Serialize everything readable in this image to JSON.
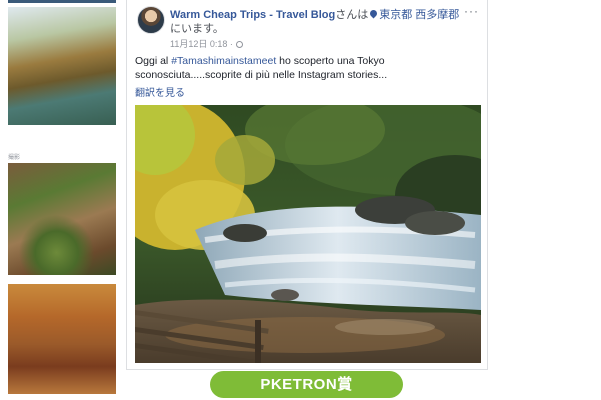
{
  "post": {
    "author": "Warm Cheap Trips - Travel Blog",
    "header_connector": "さんは",
    "location": "東京都 西多摩郡",
    "header_suffix": "にいます。",
    "timestamp": "11月12日 0:18 ·",
    "text_before_hashtag": "Oggi al ",
    "hashtag": "#Tamashimainstameet",
    "text_after_hashtag": " ho scoperto una Tokyo sconosciuta.....scoprite di più nelle Instagram stories...",
    "translate_link": "翻訳を見る",
    "more_label": "···",
    "photo_icon": "photo"
  },
  "sidebar": {
    "label": "撮影",
    "thumbnails": [
      "autumn-river-thumbnail",
      "moss-leaves-thumbnail",
      "autumn-forest-thumbnail"
    ]
  },
  "award": {
    "label": "PKETRON賞"
  },
  "colors": {
    "link_blue": "#365899",
    "award_green": "#7fbc37",
    "border": "#dddfe2"
  }
}
